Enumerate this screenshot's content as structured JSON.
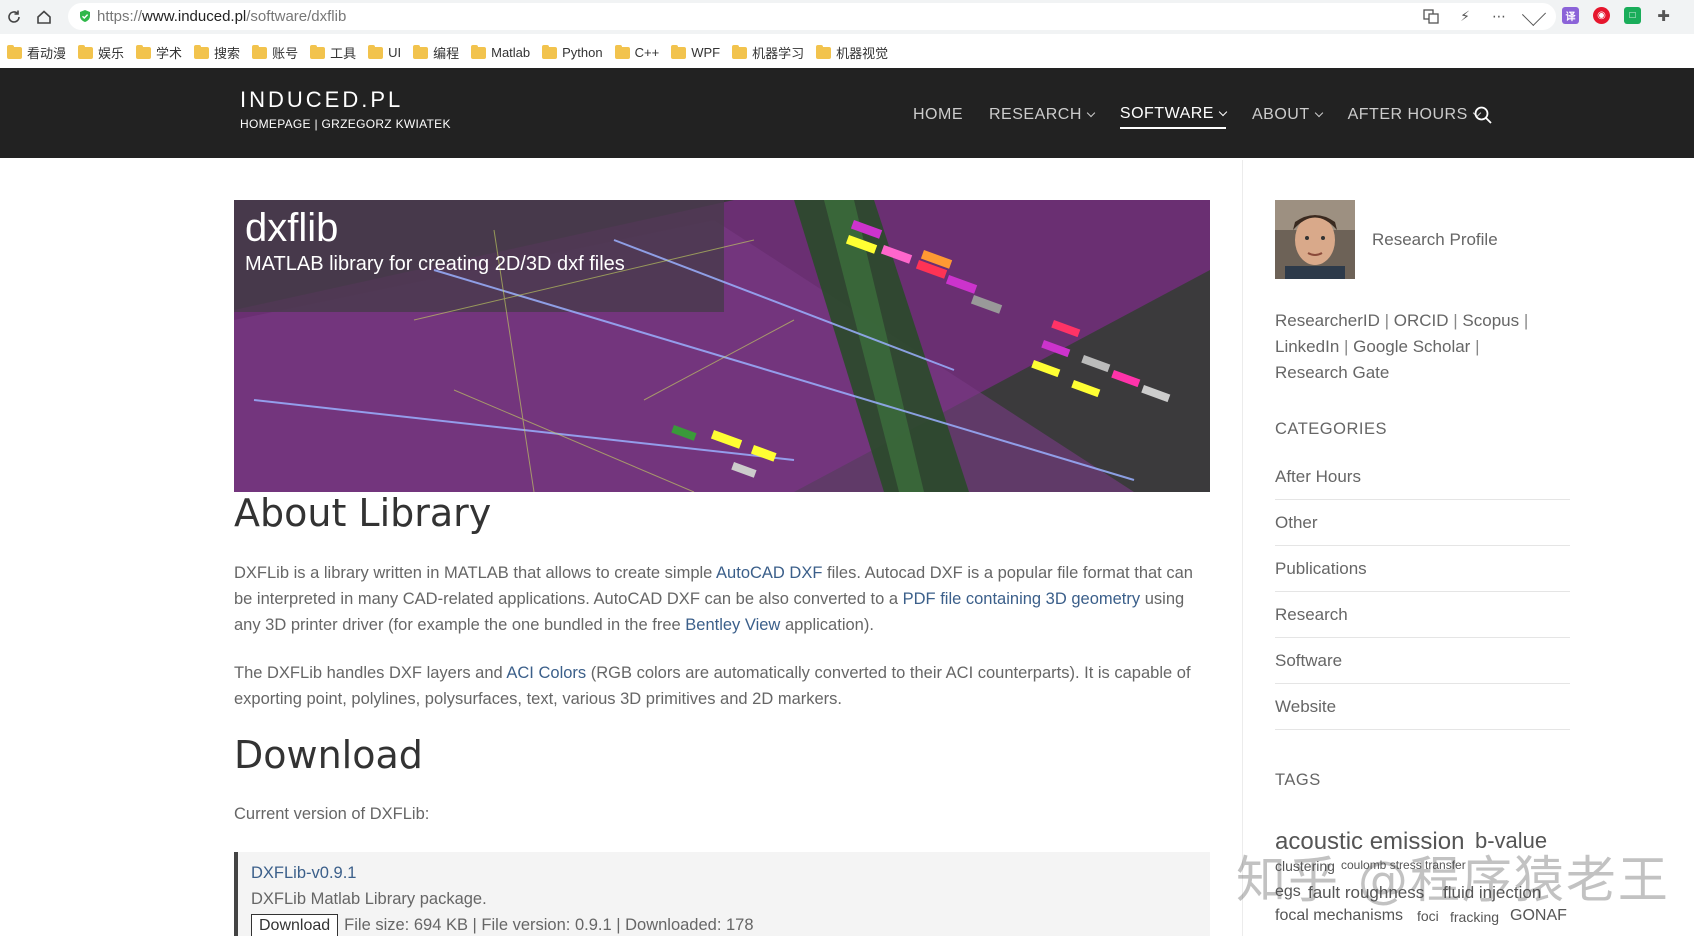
{
  "browser": {
    "url_protocol": "https://",
    "url_domain": "www.induced.pl",
    "url_path": "/software/dxflib",
    "bookmarks": [
      "看动漫",
      "娱乐",
      "学术",
      "搜索",
      "账号",
      "工具",
      "UI",
      "编程",
      "Matlab",
      "Python",
      "C++",
      "WPF",
      "机器学习",
      "机器视觉"
    ]
  },
  "site": {
    "brand_title": "INDUCED.PL",
    "brand_sub": "HOMEPAGE | GRZEGORZ KWIATEK",
    "nav": [
      {
        "label": "HOME",
        "dropdown": false,
        "active": false
      },
      {
        "label": "RESEARCH",
        "dropdown": true,
        "active": false
      },
      {
        "label": "SOFTWARE",
        "dropdown": true,
        "active": true
      },
      {
        "label": "ABOUT",
        "dropdown": true,
        "active": false
      },
      {
        "label": "AFTER HOURS",
        "dropdown": true,
        "active": false
      }
    ]
  },
  "hero": {
    "title": "dxflib",
    "subtitle": "MATLAB library for creating 2D/3D dxf files"
  },
  "about": {
    "heading": "About Library",
    "p1": {
      "a": "DXFLib is a library written in MATLAB that allows to create simple ",
      "link1": "AutoCAD DXF",
      "b": " files. Autocad DXF is a popular file format that can be interpreted in many CAD-related applications. AutoCAD DXF can be also converted to a ",
      "link2": "PDF file containing 3D geometry",
      "c": " using any 3D printer driver (for example the one bundled in the free ",
      "link3": "Bentley View",
      "d": " application)."
    },
    "p2": {
      "a": "The DXFLib handles DXF layers and ",
      "link1": "ACI Colors",
      "b": " (RGB colors are automatically converted to their ACI counterparts). It is capable of exporting point, polylines, polysurfaces, text, various 3D primitives and 2D markers."
    }
  },
  "download": {
    "heading": "Download",
    "intro": "Current version of DXFLib:",
    "name": "DXFLib-v0.9.1",
    "description": "DXFLib Matlab Library package.",
    "button": "Download",
    "meta": "File size: 694 KB | File version: 0.9.1 | Downloaded: 178"
  },
  "sidebar": {
    "profile_label": "Research Profile",
    "links": [
      "ResearcherID",
      "ORCID",
      "Scopus",
      "LinkedIn",
      "Google Scholar",
      "Research Gate"
    ],
    "categories_heading": "CATEGORIES",
    "categories": [
      "After Hours",
      "Other",
      "Publications",
      "Research",
      "Software",
      "Website"
    ],
    "tags_heading": "TAGS",
    "tags": [
      "acoustic emission",
      "b-value",
      "clustering",
      "coulomb stress transfer",
      "egs",
      "fault roughness",
      "fluid injection",
      "focal mechanisms",
      "foci",
      "fracking",
      "GONAF"
    ]
  },
  "watermark": "知乎 @程序猿老王",
  "colors": {
    "header_bg": "#222222",
    "link": "#3b5f8a",
    "text": "#666666"
  }
}
